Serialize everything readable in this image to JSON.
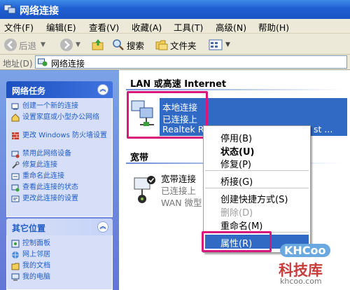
{
  "window": {
    "title": "网络连接"
  },
  "menu": [
    "文件(F)",
    "编辑(E)",
    "查看(V)",
    "收藏(A)",
    "工具(T)",
    "高级(N)",
    "帮助(H)"
  ],
  "toolbar": {
    "back": "后退",
    "search": "搜索",
    "folders": "文件夹"
  },
  "address": {
    "label": "地址(D)",
    "value": "网络连接"
  },
  "sidebar": {
    "network_tasks": {
      "title": "网络任务",
      "items": [
        "创建一个新的连接",
        "设置家庭或小型办公网络",
        "更改 Windows 防火墙设置",
        "禁用此网络设备",
        "修复此连接",
        "重命名此连接",
        "查看此连接的状态",
        "更改此连接的设置"
      ]
    },
    "other_places": {
      "title": "其它位置",
      "items": [
        "控制面板",
        "网上邻居",
        "我的文档",
        "我的电脑"
      ]
    }
  },
  "content": {
    "lan_group": "LAN 或高速 Internet",
    "local_conn": {
      "name": "本地连接",
      "status": "已连接上",
      "device": "Realtek R",
      "more": "st ..."
    },
    "broadband_group": "宽带",
    "broadband_conn": {
      "name": "宽带连接",
      "status": "已连接上",
      "device": "WAN 微型"
    }
  },
  "context_menu": {
    "items": [
      {
        "label": "停用(B)",
        "style": "normal"
      },
      {
        "label": "状态(U)",
        "style": "bold"
      },
      {
        "label": "修复(P)",
        "style": "normal"
      },
      {
        "label": "桥接(G)",
        "style": "normal"
      },
      {
        "label": "创建快捷方式(S)",
        "style": "normal"
      },
      {
        "label": "删除(D)",
        "style": "disabled"
      },
      {
        "label": "重命名(M)",
        "style": "normal"
      },
      {
        "label": "属性(R)",
        "style": "highlighted"
      }
    ]
  },
  "watermark": {
    "logo": "KHCoo",
    "cn": "科技库",
    "url": "khcoo.com"
  },
  "colors": {
    "selection": "#316ac5",
    "highlight_box": "#d9187c",
    "titlebar": "#1f5fd1"
  }
}
